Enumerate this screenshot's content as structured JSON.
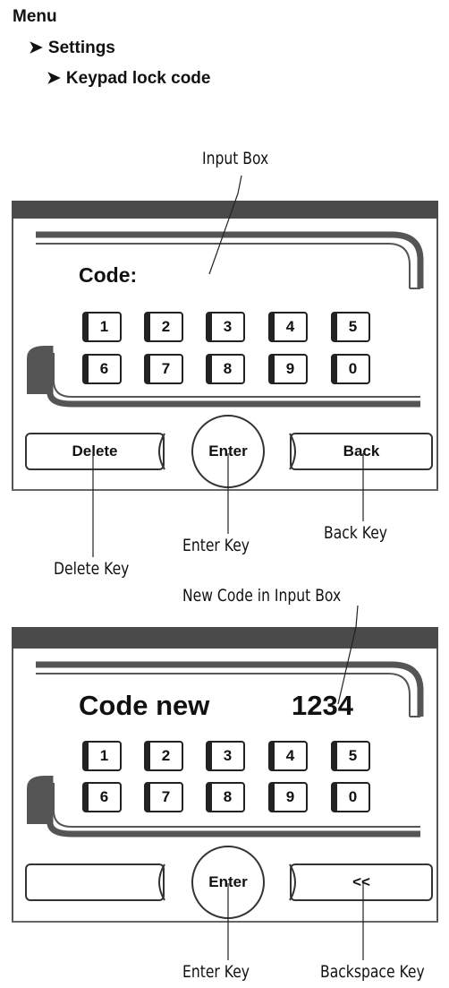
{
  "breadcrumb": {
    "menu": "Menu",
    "settings": "Settings",
    "keypad_lock_code": "Keypad lock code"
  },
  "screen1": {
    "callout_input": "Input Box",
    "code_label": "Code:",
    "keys_row1": [
      "1",
      "2",
      "3",
      "4",
      "5"
    ],
    "keys_row2": [
      "6",
      "7",
      "8",
      "9",
      "0"
    ],
    "delete_label": "Delete",
    "enter_label": "Enter",
    "back_label": "Back",
    "callout_delete": "Delete Key",
    "callout_enter": "Enter Key",
    "callout_back": "Back Key"
  },
  "screen2": {
    "callout_new_code": "New Code in Input Box",
    "code_label": "Code new",
    "code_value": "1234",
    "keys_row1": [
      "1",
      "2",
      "3",
      "4",
      "5"
    ],
    "keys_row2": [
      "6",
      "7",
      "8",
      "9",
      "0"
    ],
    "left_label": "",
    "enter_label": "Enter",
    "backspace_label": "<<",
    "callout_enter": "Enter Key",
    "callout_backspace": "Backspace Key"
  },
  "colors": {
    "title_bar": "#4a4a4a",
    "frame_gray": "#555555"
  }
}
